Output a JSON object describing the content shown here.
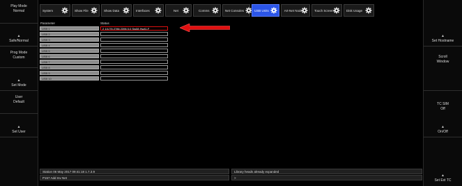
{
  "left_panel": {
    "buttons": [
      {
        "title": "Play Mode",
        "value": "Normal",
        "bottom": ""
      },
      {
        "title": "",
        "value": "",
        "bottom": "Safe/Normal"
      },
      {
        "title": "Prog Mode",
        "value": "Custom",
        "bottom": ""
      },
      {
        "title": "",
        "value": "",
        "bottom": "Set Mode"
      },
      {
        "title": "User",
        "value": "Default",
        "bottom": ""
      },
      {
        "title": "",
        "value": "",
        "bottom": "Set User"
      }
    ]
  },
  "right_panel": {
    "buttons": [
      {
        "title": "",
        "value": "",
        "bottom": "Set Hostname"
      },
      {
        "title": "Scroll",
        "value": "Window",
        "bottom": ""
      },
      {
        "title": "TC SIM",
        "value": "Off",
        "bottom": "On/Off"
      },
      {
        "title": "",
        "value": "",
        "bottom": "Set Ext TC"
      }
    ]
  },
  "tabs": [
    {
      "label": "System"
    },
    {
      "label": "Show File"
    },
    {
      "label": "Show Data"
    },
    {
      "label": "Interfaces"
    },
    {
      "label": "Net"
    },
    {
      "label": "Comms"
    },
    {
      "label": "Net Consoles"
    },
    {
      "label": "USB Units"
    },
    {
      "label": "Art-Net Nodes"
    },
    {
      "label": "Touch Screens"
    },
    {
      "label": "Disk Usage"
    }
  ],
  "active_tab": "USB Units",
  "table": {
    "header_param": "Parameter",
    "header_status": "Status",
    "rows": [
      {
        "param": "USB 1",
        "status": "2 1XJ76 2786 2396 0.0 Sw08 Hw41.F"
      },
      {
        "param": "USB 2",
        "status": ""
      },
      {
        "param": "USB 3",
        "status": ""
      },
      {
        "param": "USB 4",
        "status": ""
      },
      {
        "param": "USB 5",
        "status": ""
      },
      {
        "param": "USB 6",
        "status": ""
      },
      {
        "param": "USB 7",
        "status": ""
      },
      {
        "param": "USB 8",
        "status": ""
      },
      {
        "param": "USB 9",
        "status": ""
      },
      {
        "param": "USB 10",
        "status": ""
      }
    ]
  },
  "status_bar": {
    "line1_left": "Station 06 May 2017 09:41:18 1.7.3.9",
    "line2_left": "P157 Add Inv Net",
    "line1_right": "Library heads already expanded",
    "line2_right": ">"
  },
  "colors": {
    "active_tab": "#2b55e8",
    "highlight": "#e01010"
  }
}
